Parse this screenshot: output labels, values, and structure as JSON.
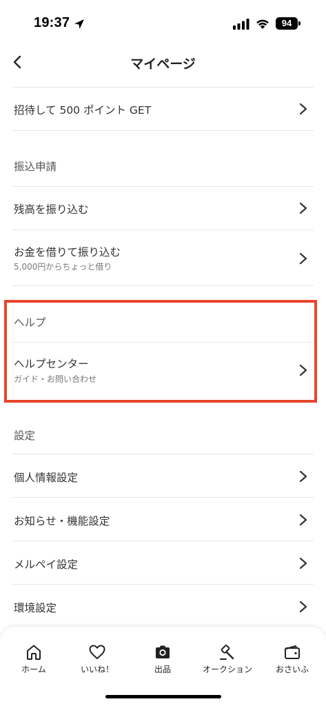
{
  "status_bar": {
    "time": "19:37",
    "battery": "94"
  },
  "header": {
    "title": "マイページ"
  },
  "items": {
    "invite": "招待して 500 ポイント GET",
    "transfer_section": "振込申請",
    "transfer_balance": "残高を振り込む",
    "borrow_transfer": "お金を借りて振り込む",
    "borrow_transfer_sub": "5,000円からちょっと借り",
    "help_section": "ヘルプ",
    "help_center": "ヘルプセンター",
    "help_center_sub": "ガイド・お問い合わせ",
    "settings_section": "設定",
    "personal_info": "個人情報設定",
    "notifications": "お知らせ・機能設定",
    "merpay_settings": "メルペイ設定",
    "environment": "環境設定"
  },
  "tabs": [
    {
      "label": "ホーム",
      "icon": "home-icon"
    },
    {
      "label": "いいね！",
      "icon": "heart-icon"
    },
    {
      "label": "出品",
      "icon": "camera-icon"
    },
    {
      "label": "オークション",
      "icon": "gavel-icon"
    },
    {
      "label": "おさいふ",
      "icon": "wallet-icon"
    }
  ],
  "colors": {
    "highlight": "#e8452c",
    "divider": "#e6e6e6"
  }
}
